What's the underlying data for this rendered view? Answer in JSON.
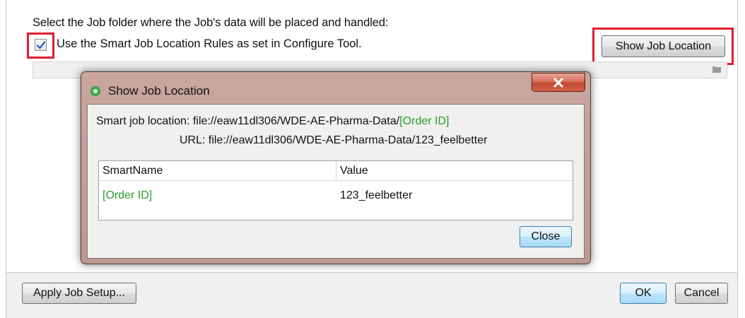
{
  "main": {
    "instruction": "Select the Job folder where the Job's data will be placed and handled:",
    "smart_rules_checkbox": {
      "label": "Use the Smart Job Location Rules as set in Configure Tool.",
      "checked": true
    },
    "show_job_location_button": "Show Job Location",
    "path_field": {
      "value": ""
    }
  },
  "footer": {
    "apply_button": "Apply Job Setup...",
    "ok_button": "OK",
    "cancel_button": "Cancel"
  },
  "dialog": {
    "title": "Show Job Location",
    "smart_location_prefix": "Smart job location: file://eaw11dl306/WDE-AE-Pharma-Data/",
    "smart_location_token": "[Order ID]",
    "url_line": "URL: file://eaw11dl306/WDE-AE-Pharma-Data/123_feelbetter",
    "table": {
      "columns": [
        "SmartName",
        "Value"
      ],
      "rows": [
        {
          "smartname": "[Order ID]",
          "value": "123_feelbetter"
        }
      ]
    },
    "close_button": "Close"
  },
  "colors": {
    "highlight": "#e31d2f",
    "token_green": "#2a9c2a"
  },
  "icons": [
    "checkmark-icon",
    "folder-icon",
    "dialog-app-icon",
    "close-x-icon"
  ]
}
